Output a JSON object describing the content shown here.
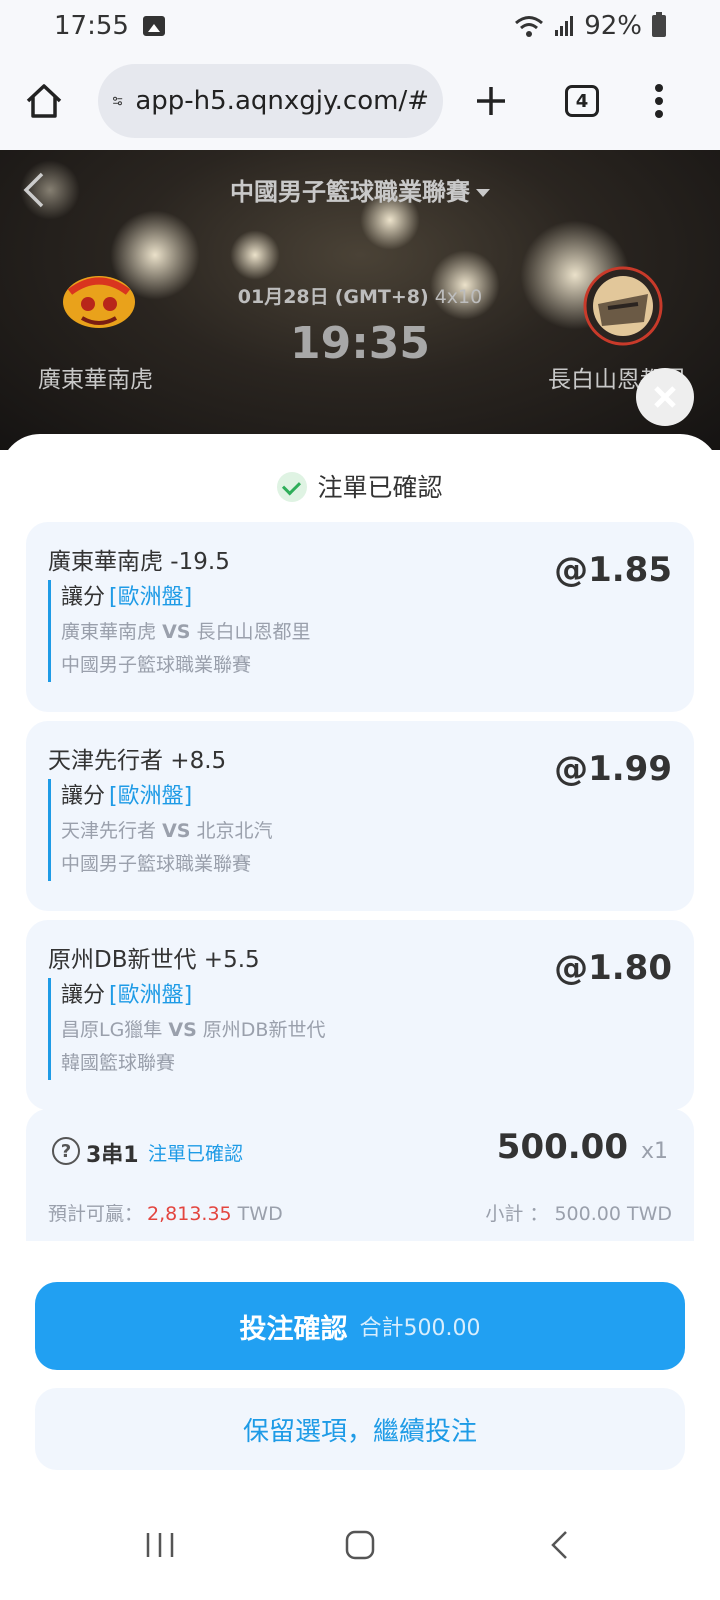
{
  "status_bar": {
    "time": "17:55",
    "battery": "92%",
    "icons": [
      "image-icon",
      "wifi-icon",
      "signal-icon",
      "battery-icon"
    ]
  },
  "browser": {
    "url": "app-h5.aqnxgjy.com/#",
    "tab_count": "4",
    "icons": [
      "home-icon",
      "site-settings-icon",
      "new-tab-icon",
      "tabs-icon",
      "more-icon"
    ]
  },
  "match": {
    "league": "中國男子籃球職業聯賽",
    "date": "01月28日",
    "timezone": "(GMT+8)",
    "format": "4x10",
    "time": "19:35",
    "home_team": "廣東華南虎",
    "away_team": "長白山恩都里"
  },
  "sheet": {
    "title": "注單已確認",
    "bets": [
      {
        "selection": "廣東華南虎 -19.5",
        "odds": "@1.85",
        "market": "讓分",
        "tag": "[歐洲盤]",
        "home": "廣東華南虎",
        "vs": "VS",
        "away": "長白山恩都里",
        "league": "中國男子籃球職業聯賽"
      },
      {
        "selection": "天津先行者 +8.5",
        "odds": "@1.99",
        "market": "讓分",
        "tag": "[歐洲盤]",
        "home": "天津先行者",
        "vs": "VS",
        "away": "北京北汽",
        "league": "中國男子籃球職業聯賽"
      },
      {
        "selection": "原州DB新世代 +5.5",
        "odds": "@1.80",
        "market": "讓分",
        "tag": "[歐洲盤]",
        "home": "昌原LG獵隼",
        "vs": "VS",
        "away": "原州DB新世代",
        "league": "韓國籃球聯賽"
      }
    ],
    "summary": {
      "help": "?",
      "type": "3串1",
      "status": "注單已確認",
      "stake": "500.00",
      "multiplier": "x1",
      "est_label": "預計可贏：",
      "est_value": "2,813.35",
      "est_currency": "TWD",
      "subtotal": "小計 ： 500.00 TWD"
    },
    "confirm_button": "投注確認",
    "confirm_total": "合計500.00",
    "keep_button": "保留選項，繼續投注"
  },
  "nav": {
    "icons": [
      "recent-apps-icon",
      "home-nav-icon",
      "back-nav-icon"
    ]
  },
  "colors": {
    "accent": "#21a0f2",
    "link": "#1e9be6",
    "win": "#e3453f",
    "card": "#f1f6fd"
  }
}
